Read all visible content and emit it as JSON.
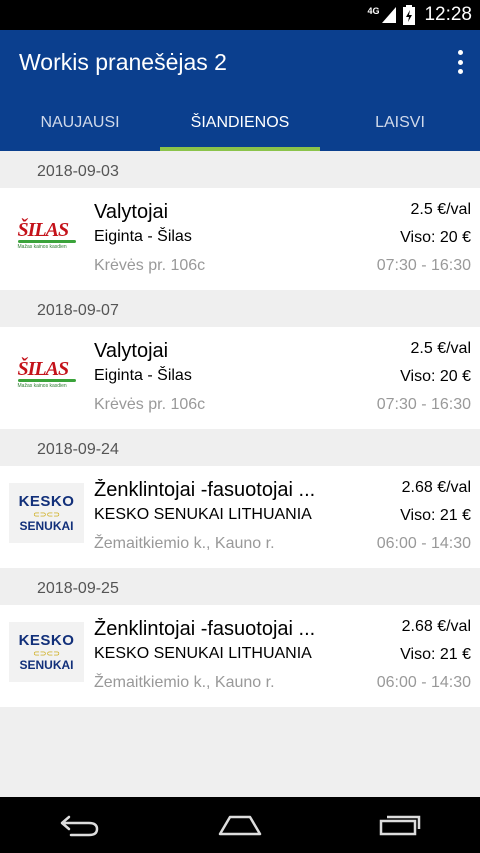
{
  "status": {
    "network": "4G",
    "time": "12:28"
  },
  "app": {
    "title": "Workis pranešėjas 2"
  },
  "tabs": [
    {
      "label": "NAUJAUSI",
      "active": false
    },
    {
      "label": "ŠIANDIENOS",
      "active": true
    },
    {
      "label": "LAISVI",
      "active": false
    }
  ],
  "jobs": [
    {
      "date": "2018-09-03",
      "logo": "silas-logo",
      "logo_text": "ŠILAS",
      "logo_tagline": "Mažas kainos kasdien",
      "title": "Valytojai",
      "company": "Eiginta - Šilas",
      "address": "Krėvės pr. 106c",
      "rate": "2.5 €/val",
      "total": "Viso: 20 €",
      "hours": "07:30 - 16:30"
    },
    {
      "date": "2018-09-07",
      "logo": "silas-logo",
      "logo_text": "ŠILAS",
      "logo_tagline": "Mažas kainos kasdien",
      "title": "Valytojai",
      "company": "Eiginta - Šilas",
      "address": "Krėvės pr. 106c",
      "rate": "2.5 €/val",
      "total": "Viso: 20 €",
      "hours": "07:30 - 16:30"
    },
    {
      "date": "2018-09-24",
      "logo": "kesko-logo",
      "logo_text_top": "KESKO",
      "logo_text_bottom": "SENUKAI",
      "title": "Ženklintojai -fasuotojai ...",
      "company": "KESKO SENUKAI LITHUANIA",
      "address": "Žemaitkiemio k., Kauno r.",
      "rate": "2.68 €/val",
      "total": "Viso: 21 €",
      "hours": "06:00 - 14:30"
    },
    {
      "date": "2018-09-25",
      "logo": "kesko-logo",
      "logo_text_top": "KESKO",
      "logo_text_bottom": "SENUKAI",
      "title": "Ženklintojai -fasuotojai ...",
      "company": "KESKO SENUKAI LITHUANIA",
      "address": "Žemaitkiemio k., Kauno r.",
      "rate": "2.68 €/val",
      "total": "Viso: 21 €",
      "hours": "06:00 - 14:30"
    }
  ],
  "colors": {
    "appbar": "#0b3f8e",
    "tab_indicator": "#8bc34a"
  }
}
